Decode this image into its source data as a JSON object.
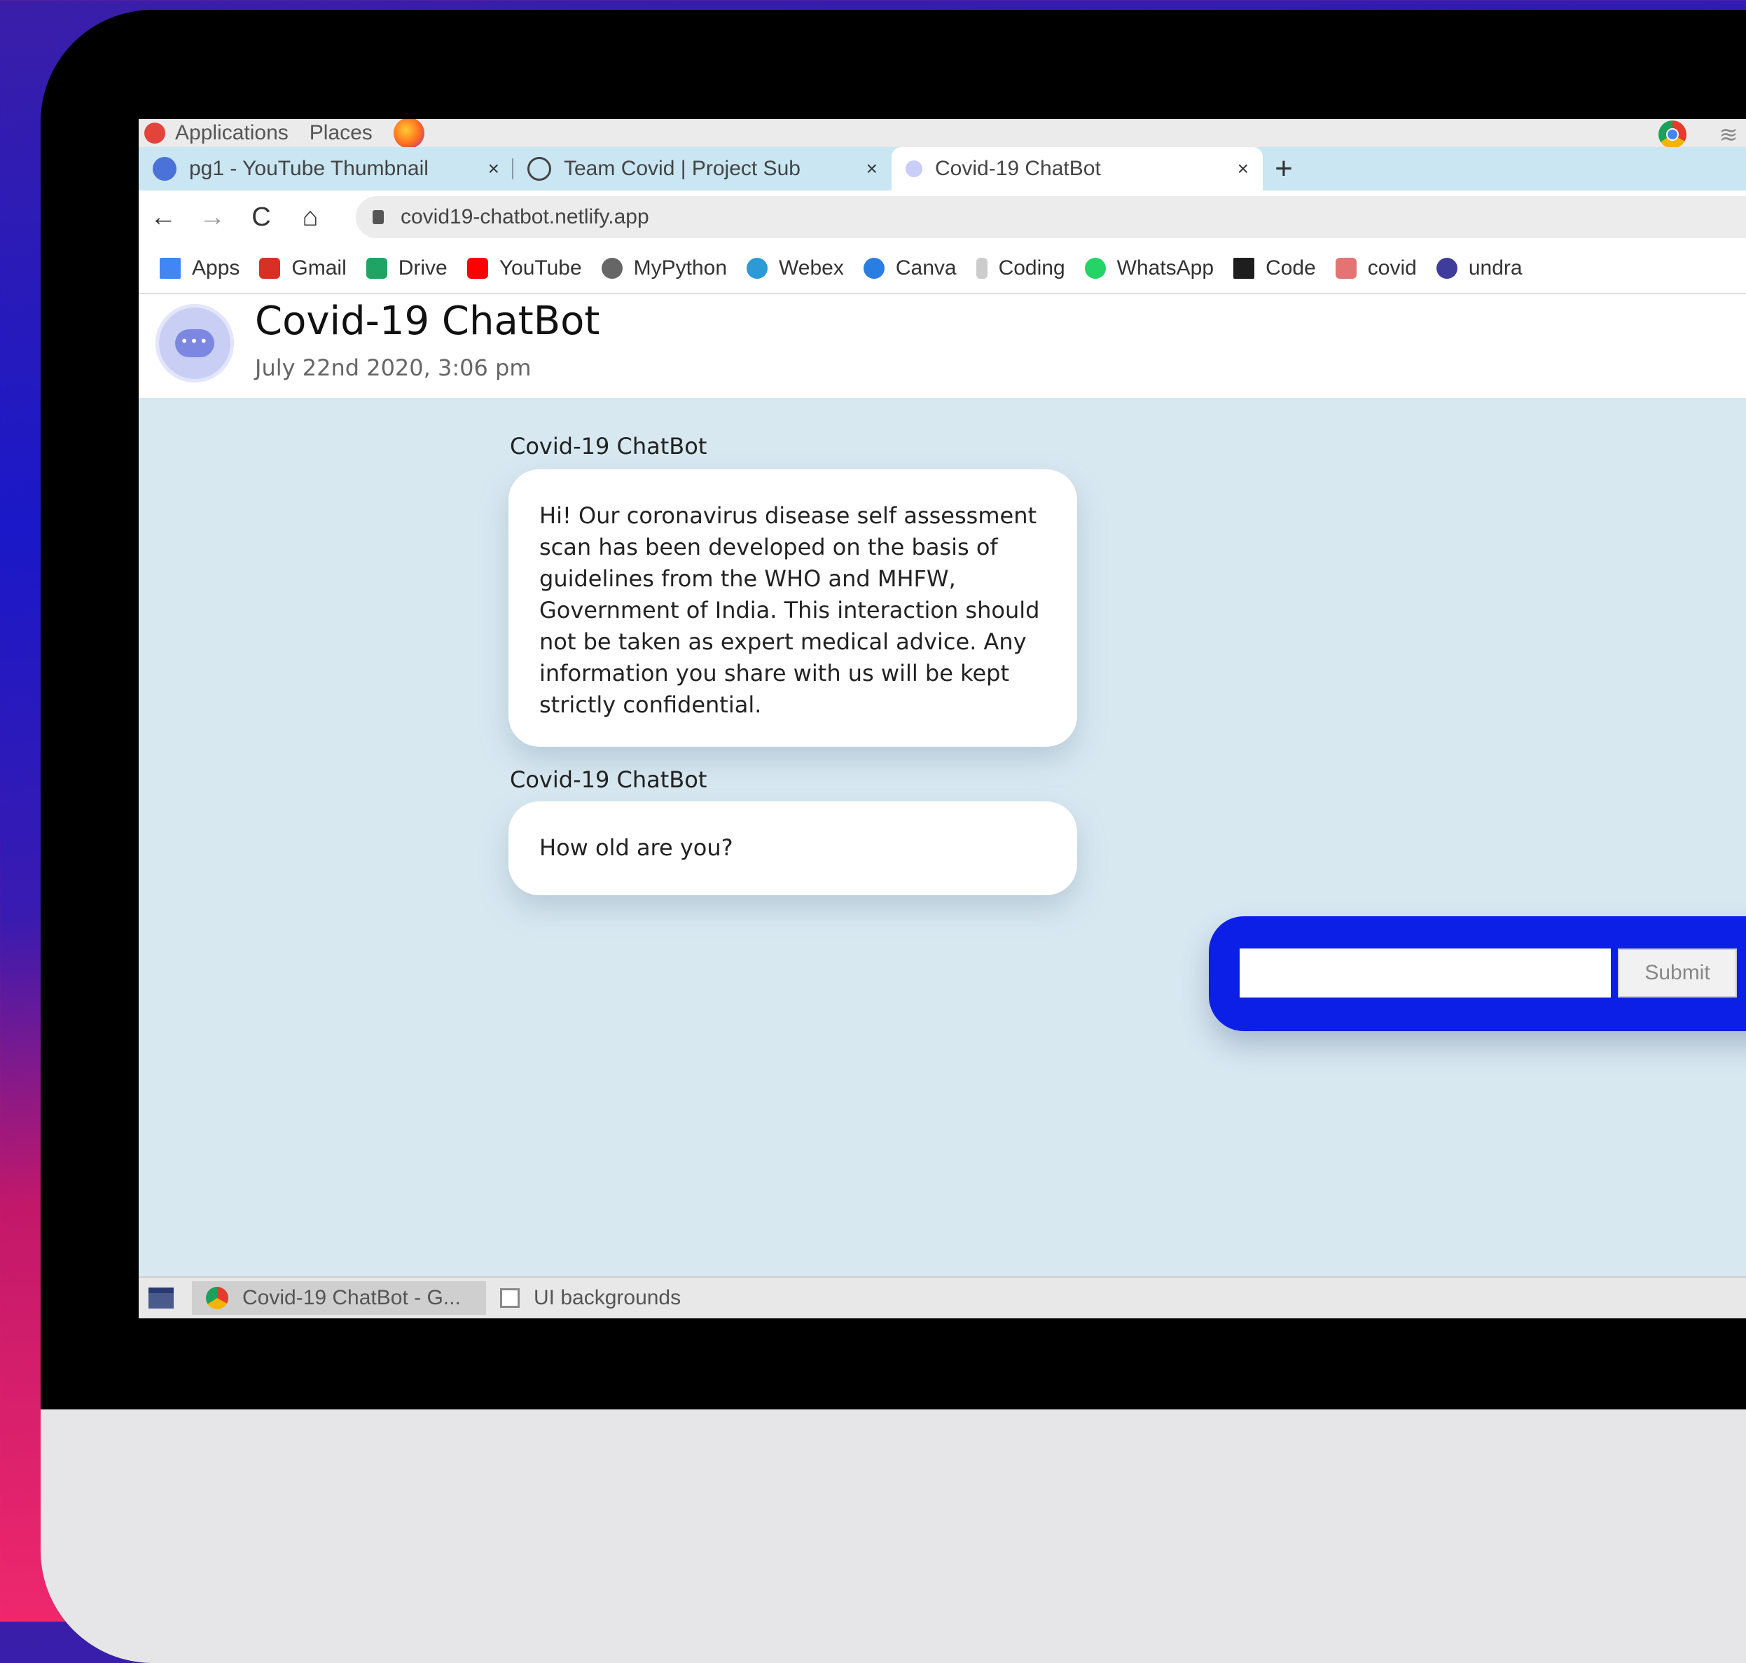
{
  "system_bar": {
    "applications_label": "Applications",
    "places_label": "Places"
  },
  "tabs": [
    {
      "title": "pg1 - YouTube Thumbnail",
      "close": "×",
      "favicon_color": "#4a72d8"
    },
    {
      "title": "Team Covid | Project Sub",
      "close": "×",
      "favicon_color": "#444444"
    },
    {
      "title": "Covid-19 ChatBot",
      "close": "×",
      "favicon_color": "#b6befa"
    }
  ],
  "new_tab": "+",
  "toolbar": {
    "back": "←",
    "forward": "→",
    "reload": "C",
    "home": "⌂",
    "url": "covid19-chatbot.netlify.app"
  },
  "bookmarks": [
    {
      "label": "Apps",
      "color": "#4285f4"
    },
    {
      "label": "Gmail",
      "color": "#d93025"
    },
    {
      "label": "Drive",
      "color": "#1fa463"
    },
    {
      "label": "YouTube",
      "color": "#ff0000"
    },
    {
      "label": "MyPython",
      "color": "#666666"
    },
    {
      "label": "Webex",
      "color": "#2b9ad6"
    },
    {
      "label": "Canva",
      "color": "#2a7de1"
    },
    {
      "label": "Coding",
      "color": "#aaaaaa"
    },
    {
      "label": "WhatsApp",
      "color": "#25d366"
    },
    {
      "label": "Code",
      "color": "#1e1e1e"
    },
    {
      "label": "covid",
      "color": "#e57373"
    },
    {
      "label": "undra",
      "color": "#3f3d9c"
    }
  ],
  "chat": {
    "title": "Covid-19 ChatBot",
    "date": "July 22nd 2020, 3:06 pm",
    "avatar_dots": "•••",
    "messages": [
      {
        "sender": "Covid-19 ChatBot",
        "text": "Hi! Our coronavirus disease self assessment scan has been developed on the basis of guidelines from the WHO and MHFW, Government of India. This interaction should not be taken as expert medical advice. Any information you share with us will be kept strictly confidential."
      },
      {
        "sender": "Covid-19 ChatBot",
        "text": "How old are you?"
      }
    ],
    "input_value": "",
    "submit_label": "Submit",
    "accent_color": "#0b1fe6"
  },
  "taskbar": {
    "items": [
      {
        "label": "Covid-19 ChatBot - G..."
      },
      {
        "label": "UI backgrounds"
      }
    ]
  }
}
